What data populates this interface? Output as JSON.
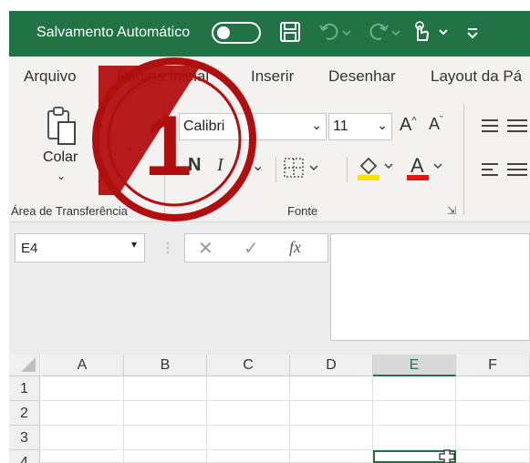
{
  "titlebar": {
    "autosave_label": "Salvamento Automático",
    "icons": [
      "toggle-switch",
      "save-icon",
      "undo-icon",
      "redo-icon",
      "touch-mode-icon",
      "customize-qat-icon"
    ]
  },
  "tabs": [
    {
      "label": "Arquivo"
    },
    {
      "label": "Página Inicial"
    },
    {
      "label": "Inserir"
    },
    {
      "label": "Desenhar"
    },
    {
      "label": "Layout da Pá"
    }
  ],
  "ribbon": {
    "clipboard": {
      "paste_label": "Colar",
      "group_label": "Área de Transferência"
    },
    "font": {
      "font_name": "Calibri",
      "font_size": "11",
      "bold": "N",
      "italic": "I",
      "group_label": "Fonte"
    }
  },
  "formula_bar": {
    "name_box": "E4",
    "fx_label": "fx"
  },
  "grid": {
    "columns": [
      "A",
      "B",
      "C",
      "D",
      "E",
      "F"
    ],
    "rows": [
      "1",
      "2",
      "3",
      "4"
    ],
    "selected_cell": "E4"
  },
  "callout": {
    "number": "1",
    "color": "#b10f0f"
  },
  "colors": {
    "accent": "#217346",
    "callout": "#b10f0f"
  }
}
